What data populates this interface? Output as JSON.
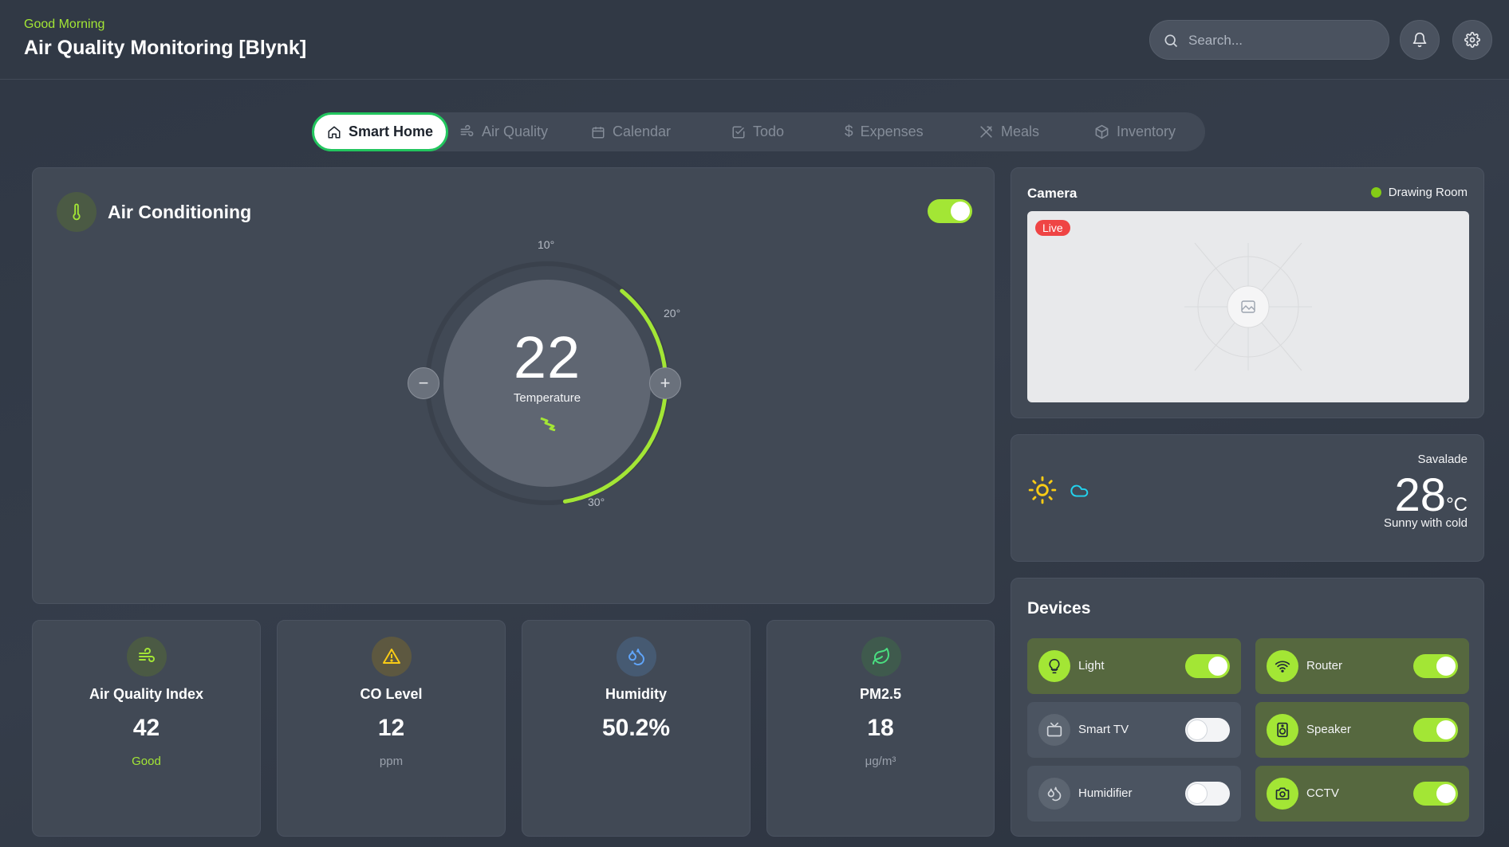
{
  "header": {
    "greeting": "Good Morning",
    "title": "Air Quality Monitoring [Blynk]",
    "search_placeholder": "Search..."
  },
  "tabs": [
    {
      "label": "Smart Home",
      "icon": "home-icon",
      "active": true
    },
    {
      "label": "Air Quality",
      "icon": "wind-icon",
      "active": false
    },
    {
      "label": "Calendar",
      "icon": "calendar-icon",
      "active": false
    },
    {
      "label": "Todo",
      "icon": "check-square-icon",
      "active": false
    },
    {
      "label": "Expenses",
      "icon": "dollar-icon",
      "active": false
    },
    {
      "label": "Meals",
      "icon": "utensils-icon",
      "active": false
    },
    {
      "label": "Inventory",
      "icon": "box-icon",
      "active": false
    }
  ],
  "ac": {
    "title": "Air Conditioning",
    "enabled": true,
    "temperature": "22",
    "temperature_label": "Temperature",
    "tick_10": "10°",
    "tick_20": "20°",
    "tick_30": "30°",
    "minus": "−",
    "plus": "+"
  },
  "camera": {
    "title": "Camera",
    "room": "Drawing Room",
    "live_label": "Live"
  },
  "weather": {
    "location": "Savalade",
    "temperature": "28",
    "unit": "°C",
    "description": "Sunny with cold"
  },
  "devices": {
    "title": "Devices",
    "items": [
      {
        "name": "Light",
        "icon": "lightbulb-icon",
        "on": true
      },
      {
        "name": "Router",
        "icon": "wifi-icon",
        "on": true
      },
      {
        "name": "Smart TV",
        "icon": "tv-icon",
        "on": false
      },
      {
        "name": "Speaker",
        "icon": "speaker-icon",
        "on": true
      },
      {
        "name": "Humidifier",
        "icon": "droplets-icon",
        "on": false
      },
      {
        "name": "CCTV",
        "icon": "camera-icon",
        "on": true
      }
    ]
  },
  "stats": [
    {
      "label": "Air Quality Index",
      "value": "42",
      "sub": "Good",
      "icon": "wind-icon"
    },
    {
      "label": "CO Level",
      "value": "12",
      "sub": "ppm",
      "icon": "warning-icon"
    },
    {
      "label": "Humidity",
      "value": "50.2%",
      "sub": "",
      "icon": "droplets-icon"
    },
    {
      "label": "PM2.5",
      "value": "18",
      "sub": "μg/m³",
      "icon": "leaf-icon"
    }
  ],
  "colors": {
    "accent": "#a3e635",
    "active_tab_border": "#22c55e",
    "live": "#ef4444",
    "good": "#a3e635"
  }
}
